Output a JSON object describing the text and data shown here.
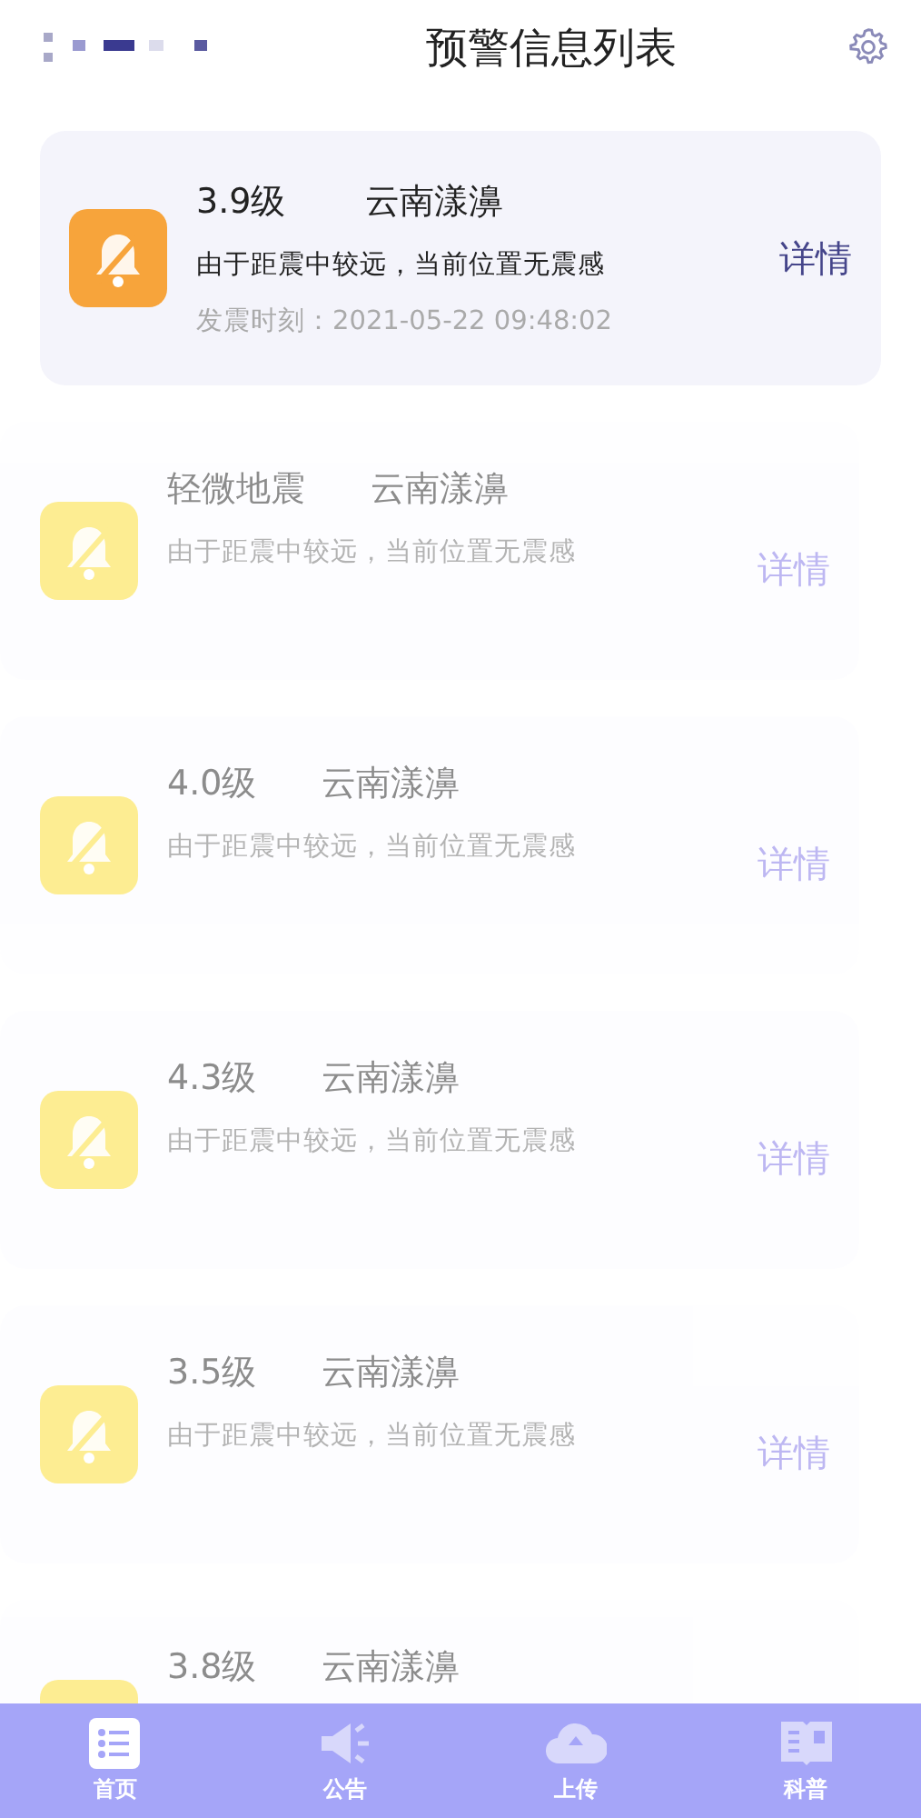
{
  "header": {
    "title": "预警信息列表"
  },
  "alerts": [
    {
      "kind": "featured",
      "magnitude": "3.9级",
      "location": "云南漾濞",
      "message": "由于距震中较远，当前位置无震感",
      "detail": "详情",
      "time": "发震时刻：2021-05-22 09:48:02"
    },
    {
      "kind": "faded",
      "magnitude": "轻微地震",
      "location": "云南漾濞",
      "message": "由于距震中较远，当前位置无震感",
      "detail": "详情"
    },
    {
      "kind": "faded",
      "magnitude": "4.0级",
      "location": "云南漾濞",
      "message": "由于距震中较远，当前位置无震感",
      "detail": "详情"
    },
    {
      "kind": "faded",
      "magnitude": "4.3级",
      "location": "云南漾濞",
      "message": "由于距震中较远，当前位置无震感",
      "detail": "详情"
    },
    {
      "kind": "faded",
      "magnitude": "3.5级",
      "location": "云南漾濞",
      "message": "由于距震中较远，当前位置无震感",
      "detail": "详情"
    },
    {
      "kind": "faded",
      "magnitude": "3.8级",
      "location": "云南漾濞"
    }
  ],
  "tab_bar": [
    {
      "label": "首页",
      "kind": "list",
      "selected": true
    },
    {
      "label": "公告",
      "kind": "speaker",
      "selected": false
    },
    {
      "label": "上传",
      "kind": "cloud",
      "selected": false
    },
    {
      "label": "科普",
      "kind": "book",
      "selected": false
    }
  ]
}
